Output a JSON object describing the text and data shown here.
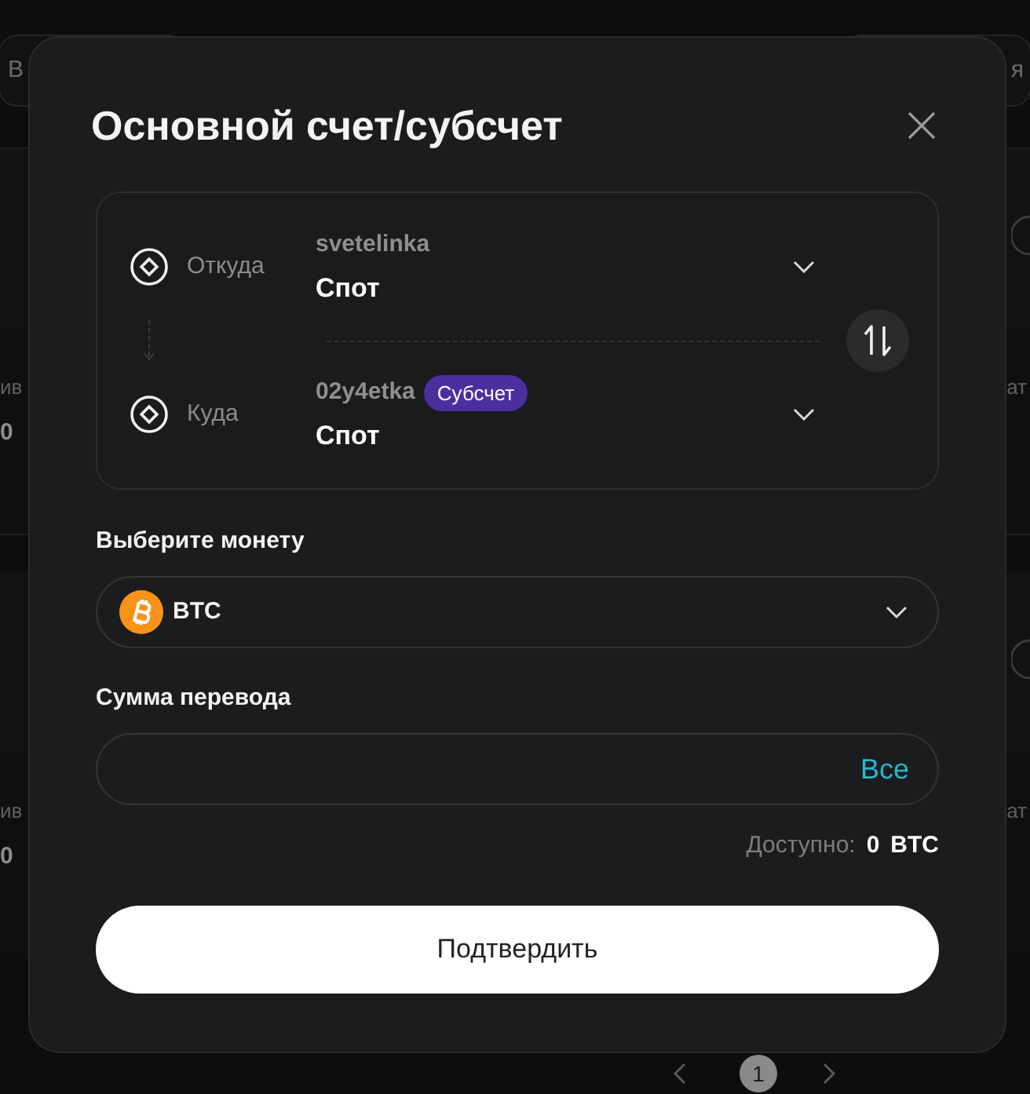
{
  "background_page": {
    "top_buttons": [
      {
        "label": "В"
      },
      {
        "label": "я"
      }
    ],
    "rows": [
      {
        "left_label": "ив",
        "left_value": "0",
        "right_label": "ат"
      },
      {
        "left_label": "ив",
        "left_value": "0",
        "right_label": "ат"
      }
    ],
    "pagination": {
      "pages": [
        {
          "label": "1",
          "selected": true
        }
      ]
    }
  },
  "dialog": {
    "title": "Основной счет/субсчет",
    "transfer": [
      {
        "label": "Откуда",
        "account_name": "svetelinka",
        "wallet": "Спот"
      },
      {
        "label": "Куда",
        "account_name": "02y4etka",
        "badge": "Субсчет",
        "wallet": "Спот"
      }
    ],
    "coin": {
      "label": "Выберите монету",
      "value": "BTC"
    },
    "amount": {
      "label": "Сумма перевода",
      "max_button": "Все"
    },
    "available": {
      "label": "Доступно:",
      "amount": "0",
      "currency": "BTC"
    },
    "confirm_button": "Подтвердить"
  }
}
